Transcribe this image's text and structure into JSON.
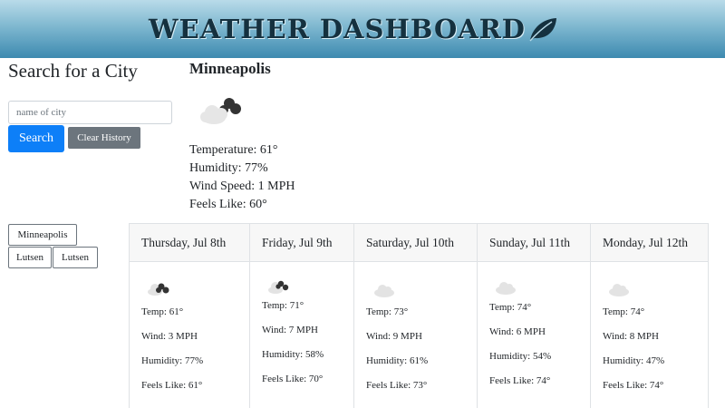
{
  "header": {
    "title": "WEATHER DASHBOARD",
    "icon": "leaf-icon"
  },
  "sidebar": {
    "title": "Search for a City",
    "input_placeholder": "name of city",
    "input_value": "",
    "search_label": "Search",
    "clear_label": "Clear History",
    "history": [
      "Minneapolis",
      "Lutsen",
      "Lutsen"
    ]
  },
  "current": {
    "city": "Minneapolis",
    "icon": "partly-cloudy-icon",
    "temperature": "Temperature: 61°",
    "humidity": "Humidity: 77%",
    "wind": "Wind Speed: 1 MPH",
    "feels_like": "Feels Like: 60°"
  },
  "forecast": [
    {
      "date": "Thursday, Jul 8th",
      "icon": "dark-clouds-icon",
      "temp": "Temp: 61°",
      "wind": "Wind: 3 MPH",
      "humidity": "Humidity: 77%",
      "feels": "Feels Like: 61°"
    },
    {
      "date": "Friday, Jul 9th",
      "icon": "dark-clouds-icon",
      "temp": "Temp: 71°",
      "wind": "Wind: 7 MPH",
      "humidity": "Humidity: 58%",
      "feels": "Feels Like: 70°"
    },
    {
      "date": "Saturday, Jul 10th",
      "icon": "cloud-icon",
      "temp": "Temp: 73°",
      "wind": "Wind: 9 MPH",
      "humidity": "Humidity: 61%",
      "feels": "Feels Like: 73°"
    },
    {
      "date": "Sunday, Jul 11th",
      "icon": "cloud-icon",
      "temp": "Temp: 74°",
      "wind": "Wind: 6 MPH",
      "humidity": "Humidity: 54%",
      "feels": "Feels Like: 74°"
    },
    {
      "date": "Monday, Jul 12th",
      "icon": "cloud-icon",
      "temp": "Temp: 74°",
      "wind": "Wind: 8 MPH",
      "humidity": "Humidity: 47%",
      "feels": "Feels Like: 74°"
    }
  ],
  "colors": {
    "primary": "#0d7ff8",
    "secondary": "#6c757d",
    "banner": "#3d8ab0"
  }
}
